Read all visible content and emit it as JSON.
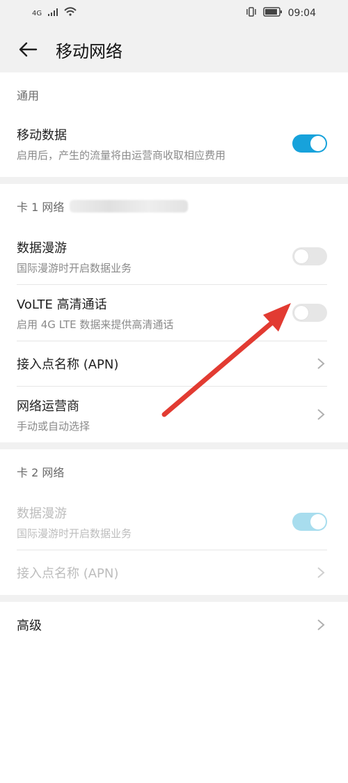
{
  "status": {
    "network": "4G",
    "time": "09:04"
  },
  "appbar": {
    "title": "移动网络"
  },
  "general": {
    "header": "通用",
    "mobile_data": {
      "title": "移动数据",
      "subtitle": "启用后，产生的流量将由运营商收取相应费用",
      "on": true
    }
  },
  "sim1": {
    "header": "卡 1 网络",
    "roaming": {
      "title": "数据漫游",
      "subtitle": "国际漫游时开启数据业务",
      "on": false
    },
    "volte": {
      "title": "VoLTE 高清通话",
      "subtitle": "启用 4G LTE 数据来提供高清通话",
      "on": false
    },
    "apn": {
      "title": "接入点名称 (APN)"
    },
    "operator": {
      "title": "网络运营商",
      "subtitle": "手动或自动选择"
    }
  },
  "sim2": {
    "header": "卡 2 网络",
    "roaming": {
      "title": "数据漫游",
      "subtitle": "国际漫游时开启数据业务",
      "on": true
    },
    "apn": {
      "title": "接入点名称 (APN)"
    }
  },
  "advanced": {
    "title": "高级"
  },
  "colors": {
    "accent": "#17a2db",
    "accent_disabled": "#a8ddee",
    "arrow": "#e23b32"
  }
}
